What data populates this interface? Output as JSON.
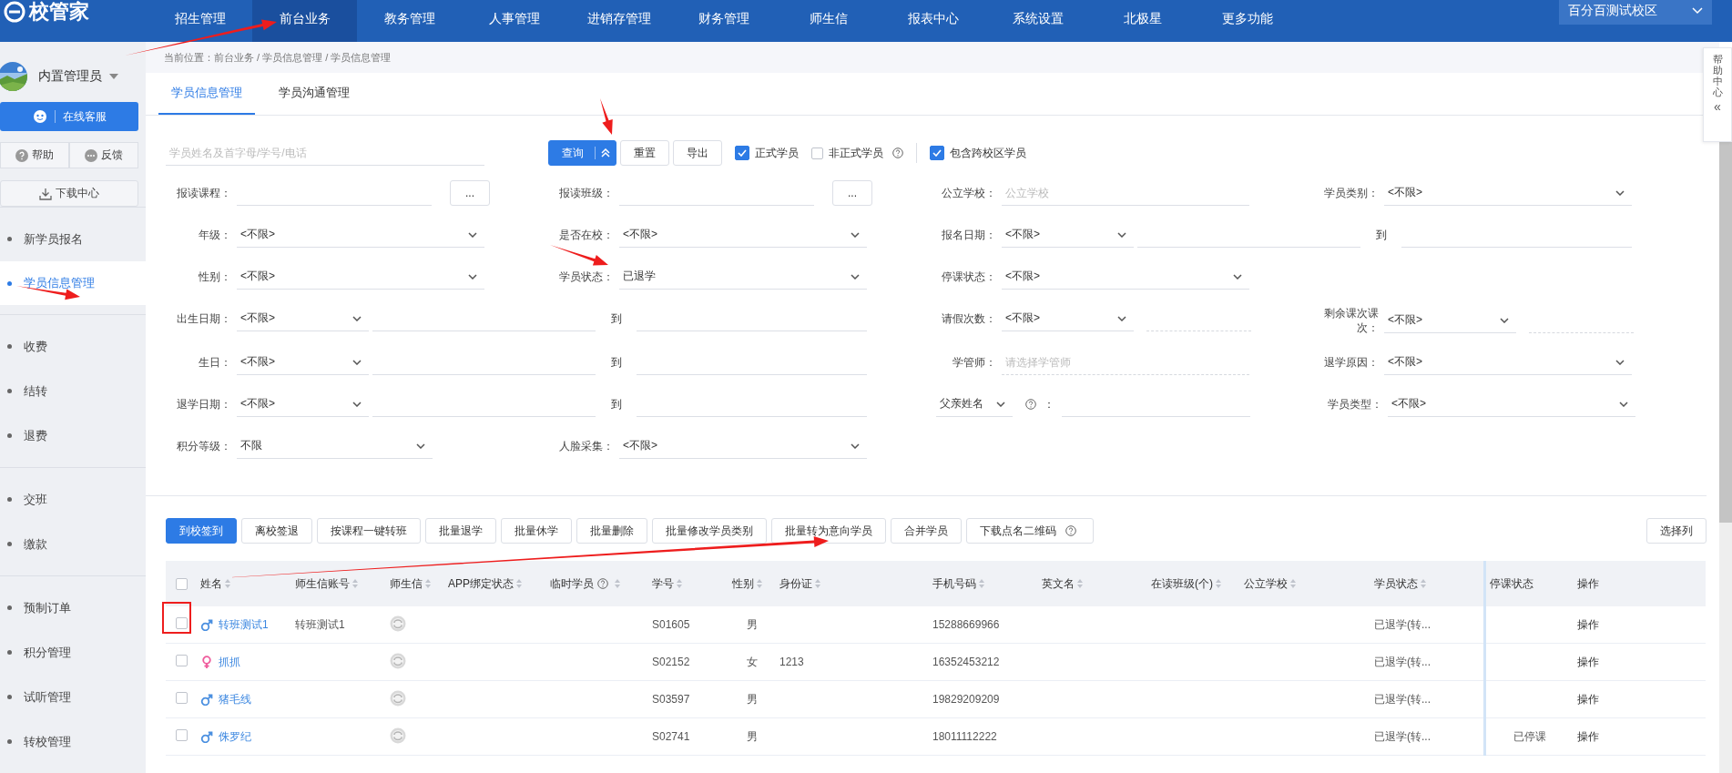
{
  "top_nav": {
    "logo": "校管家",
    "items": [
      {
        "label": "招生管理",
        "selected": false
      },
      {
        "label": "前台业务",
        "selected": true
      },
      {
        "label": "教务管理",
        "selected": false
      },
      {
        "label": "人事管理",
        "selected": false
      },
      {
        "label": "进销存管理",
        "selected": false
      },
      {
        "label": "财务管理",
        "selected": false
      },
      {
        "label": "师生信",
        "selected": false
      },
      {
        "label": "报表中心",
        "selected": false
      },
      {
        "label": "系统设置",
        "selected": false
      },
      {
        "label": "北极星",
        "selected": false
      },
      {
        "label": "更多功能",
        "selected": false
      }
    ],
    "campus": "百分百测试校区"
  },
  "sidebar": {
    "user": "内置管理员",
    "service_button": "在线客服",
    "help": "帮助",
    "feedback": "反馈",
    "download": "下载中心",
    "groups": [
      {
        "items": [
          {
            "label": "新学员报名",
            "selected": false
          },
          {
            "label": "学员信息管理",
            "selected": true
          }
        ]
      },
      {
        "items": [
          {
            "label": "收费",
            "selected": false
          },
          {
            "label": "结转",
            "selected": false
          },
          {
            "label": "退费",
            "selected": false
          }
        ]
      },
      {
        "items": [
          {
            "label": "交班",
            "selected": false
          },
          {
            "label": "缴款",
            "selected": false
          }
        ]
      },
      {
        "items": [
          {
            "label": "预制订单",
            "selected": false
          },
          {
            "label": "积分管理",
            "selected": false
          },
          {
            "label": "试听管理",
            "selected": false
          },
          {
            "label": "转校管理",
            "selected": false
          }
        ]
      }
    ]
  },
  "help_center": {
    "label": "帮助中心",
    "toggle": "«"
  },
  "breadcrumb": "当前位置：前台业务 / 学员信息管理 / 学员信息管理",
  "tabs": [
    {
      "label": "学员信息管理",
      "selected": true
    },
    {
      "label": "学员沟通管理",
      "selected": false
    }
  ],
  "search": {
    "placeholder": "学员姓名及首字母/学号/电话",
    "buttons": [
      {
        "label": "查询",
        "kind": "split"
      },
      {
        "label": "重置",
        "kind": "default"
      },
      {
        "label": "导出",
        "kind": "default"
      }
    ],
    "checkbox_groups": [
      [
        {
          "label": "正式学员",
          "checked": true,
          "kind": "plain"
        },
        {
          "label": "非正式学员",
          "checked": false,
          "kind": "help"
        }
      ],
      [
        {
          "label": "包含跨校区学员",
          "checked": true,
          "kind": "plain"
        }
      ]
    ]
  },
  "filters": [
    [
      {
        "kind": "picker",
        "label": "报读课程：",
        "button": "..."
      },
      {
        "kind": "picker",
        "label": "报读班级：",
        "button": "..."
      },
      {
        "kind": "text",
        "label": "公立学校：",
        "placeholder": "公立学校"
      },
      {
        "kind": "select",
        "label": "学员类别：",
        "value": "<不限>"
      }
    ],
    [
      {
        "kind": "select",
        "label": "年级：",
        "value": "<不限>"
      },
      {
        "kind": "select",
        "label": "是否在校：",
        "value": "<不限>"
      },
      {
        "kind": "range",
        "label": "报名日期：",
        "value": "<不限>",
        "to": "到"
      }
    ],
    [
      {
        "kind": "select",
        "label": "性别：",
        "value": "<不限>"
      },
      {
        "kind": "select",
        "label": "学员状态：",
        "value": "已退学"
      },
      {
        "kind": "select",
        "label": "停课状态：",
        "value": "<不限>"
      }
    ],
    [
      {
        "kind": "range",
        "label": "出生日期：",
        "value": "<不限>",
        "to": "到"
      },
      {
        "kind": "count",
        "label": "请假次数：",
        "value": "<不限>"
      },
      {
        "kind": "count",
        "label": "剩余课次课次：",
        "value": "<不限>"
      }
    ],
    [
      {
        "kind": "range",
        "label": "生日：",
        "value": "<不限>",
        "to": "到"
      },
      {
        "kind": "lookup",
        "label": "学管师：",
        "placeholder": "请选择学管师"
      },
      {
        "kind": "select",
        "label": "退学原因：",
        "value": "<不限>"
      }
    ],
    [
      {
        "kind": "range",
        "label": "退学日期：",
        "value": "<不限>",
        "to": "到"
      },
      {
        "kind": "field_select",
        "value": "父亲姓名",
        "suffix": "："
      },
      {
        "kind": "select",
        "label": "学员类型：",
        "value": "<不限>"
      }
    ],
    [
      {
        "kind": "select_short",
        "label": "积分等级：",
        "value": "不限"
      },
      {
        "kind": "select",
        "label": "人脸采集：",
        "value": "<不限>"
      }
    ]
  ],
  "actions": {
    "buttons": [
      {
        "label": "到校签到",
        "kind": "primary"
      },
      {
        "label": "离校签退",
        "kind": "default"
      },
      {
        "label": "按课程一键转班",
        "kind": "default"
      },
      {
        "label": "批量退学",
        "kind": "default"
      },
      {
        "label": "批量休学",
        "kind": "default"
      },
      {
        "label": "批量删除",
        "kind": "default"
      },
      {
        "label": "批量修改学员类别",
        "kind": "default"
      },
      {
        "label": "批量转为意向学员",
        "kind": "default"
      },
      {
        "label": "合并学员",
        "kind": "default"
      },
      {
        "label": "下载点名二维码",
        "kind": "help"
      }
    ],
    "column_button": "选择列"
  },
  "table": {
    "all_checked": false,
    "columns": [
      {
        "label": "姓名",
        "kind": "sortable"
      },
      {
        "label": "师生信账号",
        "kind": "sortable"
      },
      {
        "label": "师生信",
        "kind": "sortable"
      },
      {
        "label": "APP绑定状态",
        "kind": "sortable"
      },
      {
        "label": "临时学员",
        "kind": "sortable_help"
      },
      {
        "label": "学号",
        "kind": "sortable"
      },
      {
        "label": "性别",
        "kind": "sortable"
      },
      {
        "label": "身份证",
        "kind": "sortable"
      },
      {
        "label": "手机号码",
        "kind": "sortable"
      },
      {
        "label": "英文名",
        "kind": "sortable"
      },
      {
        "label": "在读班级(个)",
        "kind": "sortable"
      },
      {
        "label": "公立学校",
        "kind": "sortable"
      },
      {
        "label": "学员状态",
        "kind": "sortable"
      },
      {
        "label": "停课状态",
        "kind": "plain"
      },
      {
        "label": "操作",
        "kind": "plain"
      }
    ],
    "rows": [
      {
        "checked": false,
        "kind": "male",
        "color": "#4a8fe0",
        "name": "转班测试1",
        "account": "转班测试1",
        "student_no": "S01605",
        "sex": "男",
        "id_card": "",
        "phone": "15288669966",
        "status": "已退学(转...",
        "suspension": "",
        "action": "操作"
      },
      {
        "checked": false,
        "kind": "female",
        "color": "#ef5b9c",
        "name": "抓抓",
        "account": "",
        "student_no": "S02152",
        "sex": "女",
        "id_card": "1213",
        "phone": "16352453212",
        "status": "已退学(转...",
        "suspension": "",
        "action": "操作"
      },
      {
        "checked": false,
        "kind": "male",
        "color": "#4a8fe0",
        "name": "猪毛线",
        "account": "",
        "student_no": "S03597",
        "sex": "男",
        "id_card": "",
        "phone": "19829209209",
        "status": "已退学(转...",
        "suspension": "",
        "action": "操作"
      },
      {
        "checked": false,
        "kind": "male",
        "color": "#4a8fe0",
        "name": "侏罗纪",
        "account": "",
        "student_no": "S02741",
        "sex": "男",
        "id_card": "",
        "phone": "18011112222",
        "status": "已退学(转...",
        "suspension": "已停课",
        "action": "操作"
      }
    ]
  }
}
